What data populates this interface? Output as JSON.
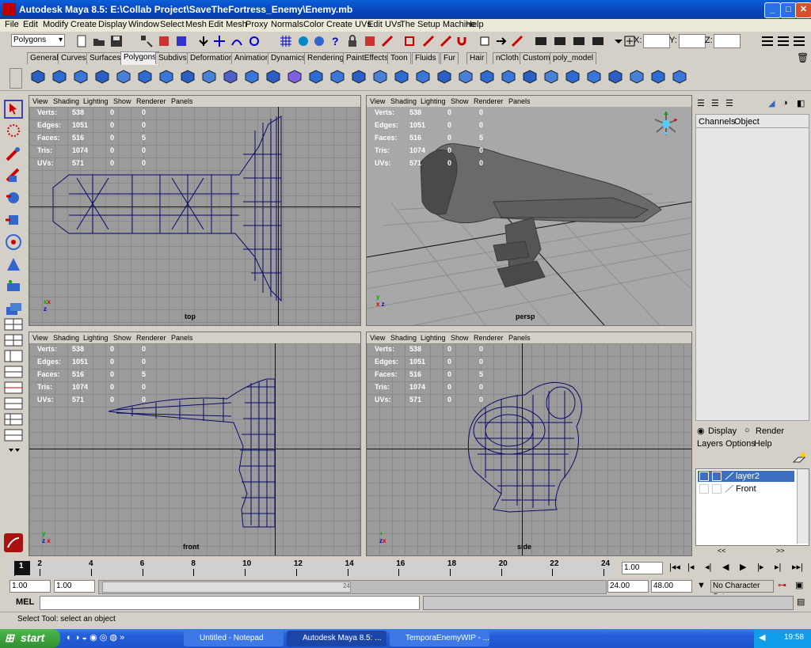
{
  "window": {
    "title": "Autodesk Maya 8.5: E:\\Collab Project\\SaveTheFortress_Enemy\\Enemy.mb"
  },
  "menu": [
    "File",
    "Edit",
    "Modify",
    "Create",
    "Display",
    "Window",
    "Select",
    "Mesh",
    "Edit Mesh",
    "Proxy",
    "Normals",
    "Color",
    "Create UVs",
    "Edit UVs",
    "The Setup Machine",
    "Help"
  ],
  "status": {
    "mode": "Polygons",
    "x_label": "X:",
    "y_label": "Y:",
    "z_label": "Z:"
  },
  "shelf_tabs": [
    "General",
    "Curves",
    "Surfaces",
    "Polygons",
    "Subdivs",
    "Deformation",
    "Animation",
    "Dynamics",
    "Rendering",
    "PaintEffects",
    "Toon",
    "Fluids",
    "Fur",
    "Hair",
    "nCloth",
    "Custom",
    "poly_model"
  ],
  "viewport_menu": [
    "View",
    "Shading",
    "Lighting",
    "Show",
    "Renderer",
    "Panels"
  ],
  "hud": {
    "labels": [
      "Verts:",
      "Edges:",
      "Faces:",
      "Tris:",
      "UVs:"
    ],
    "values": [
      [
        "538",
        "0",
        "0"
      ],
      [
        "1051",
        "0",
        "0"
      ],
      [
        "516",
        "0",
        "5"
      ],
      [
        "1074",
        "0",
        "0"
      ],
      [
        "571",
        "0",
        "0"
      ]
    ]
  },
  "viewports": {
    "top": "top",
    "persp": "persp",
    "front": "front",
    "side": "side"
  },
  "channel_box": {
    "channels": "Channels",
    "object": "Object"
  },
  "layer_editor": {
    "display": "Display",
    "render": "Render",
    "menu": [
      "Layers",
      "Options",
      "Help"
    ],
    "layers": [
      "layer2",
      "Front"
    ]
  },
  "time_slider": {
    "ticks": [
      "1",
      "2",
      "4",
      "6",
      "8",
      "10",
      "12",
      "14",
      "16",
      "18",
      "20",
      "22",
      "24"
    ],
    "current": "1.00"
  },
  "range_slider": {
    "start": "1.00",
    "start2": "1.00",
    "end": "24.00",
    "end2": "48.00",
    "charset": "No Character Set",
    "slider_end_label": "24"
  },
  "command_line": {
    "label": "MEL"
  },
  "help_line": {
    "text": "Select Tool: select an object"
  },
  "taskbar": {
    "start": "start",
    "tasks": [
      "Untitled - Notepad",
      "Autodesk Maya 8.5: ...",
      "TemporaEnemyWIP - ..."
    ],
    "clock": "19:58"
  }
}
